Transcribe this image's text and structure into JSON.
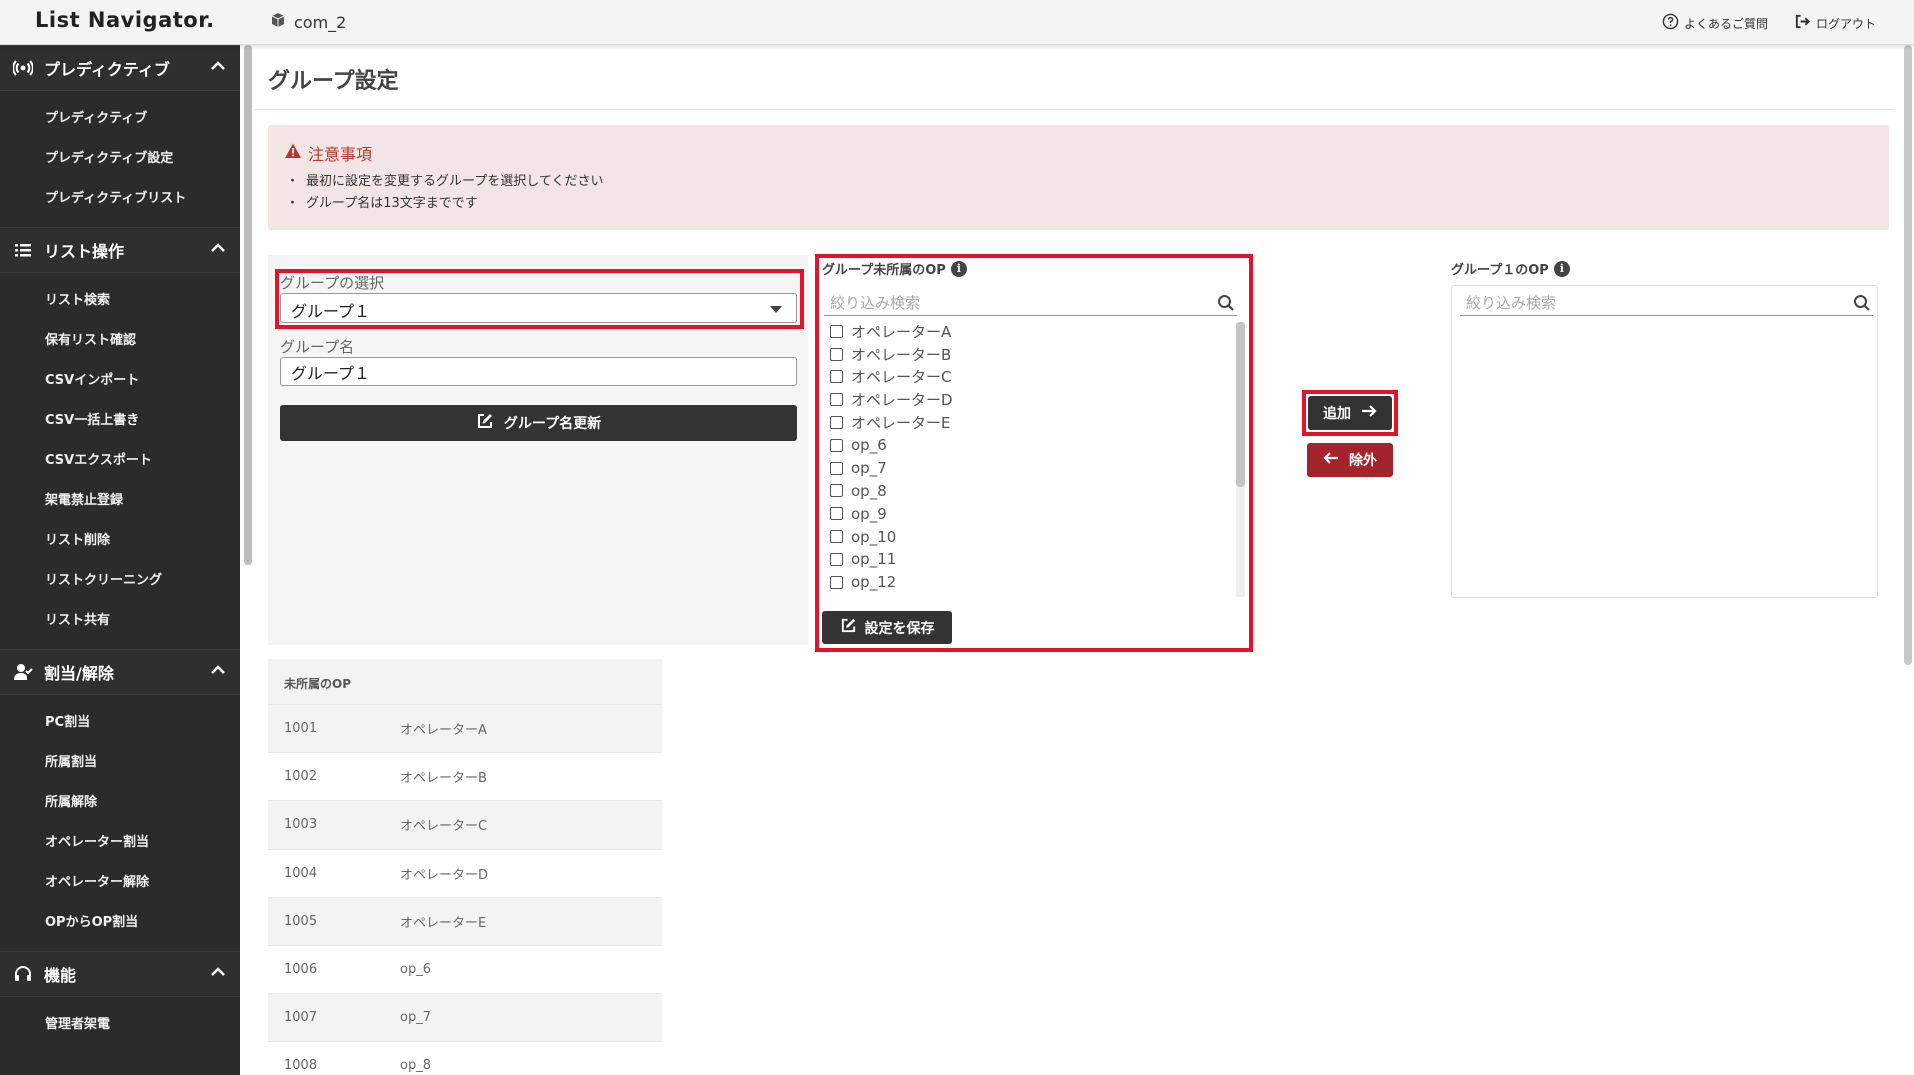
{
  "header": {
    "logo": "List Navigator.",
    "company": "com_2",
    "faq": "よくあるご質問",
    "logout": "ログアウト"
  },
  "sidebar": {
    "sections": [
      {
        "title": "プレディクティブ",
        "icon": "broadcast-icon",
        "items": [
          "プレディクティブ",
          "プレディクティブ設定",
          "プレディクティブリスト"
        ]
      },
      {
        "title": "リスト操作",
        "icon": "list-icon",
        "items": [
          "リスト検索",
          "保有リスト確認",
          "CSVインポート",
          "CSV一括上書き",
          "CSVエクスポート",
          "架電禁止登録",
          "リスト削除",
          "リストクリーニング",
          "リスト共有"
        ]
      },
      {
        "title": "割当/解除",
        "icon": "user-check-icon",
        "items": [
          "PC割当",
          "所属割当",
          "所属解除",
          "オペレーター割当",
          "オペレーター解除",
          "OPからOP割当"
        ]
      },
      {
        "title": "機能",
        "icon": "headset-icon",
        "items": [
          "管理者架電"
        ]
      }
    ]
  },
  "page": {
    "title": "グループ設定"
  },
  "notice": {
    "title": "注意事項",
    "lines": [
      "最初に設定を変更するグループを選択してください",
      "グループ名は13文字までです"
    ]
  },
  "form": {
    "select_label": "グループの選択",
    "select_value": "グループ１",
    "name_label": "グループ名",
    "name_value": "グループ１",
    "rename_button": "グループ名更新"
  },
  "unassigned": {
    "title": "グループ未所属のOP",
    "search_placeholder": "絞り込み検索",
    "items": [
      "オペレーターA",
      "オペレーターB",
      "オペレーターC",
      "オペレーターD",
      "オペレーターE",
      "op_6",
      "op_7",
      "op_8",
      "op_9",
      "op_10",
      "op_11",
      "op_12"
    ],
    "save_button": "設定を保存"
  },
  "actions": {
    "add": "追加",
    "remove": "除外"
  },
  "group_op": {
    "title": "グループ１のOP",
    "search_placeholder": "絞り込み検索"
  },
  "table": {
    "header": "未所属のOP",
    "rows": [
      [
        "1001",
        "オペレーターA"
      ],
      [
        "1002",
        "オペレーターB"
      ],
      [
        "1003",
        "オペレーターC"
      ],
      [
        "1004",
        "オペレーターD"
      ],
      [
        "1005",
        "オペレーターE"
      ],
      [
        "1006",
        "op_6"
      ],
      [
        "1007",
        "op_7"
      ],
      [
        "1008",
        "op_8"
      ]
    ]
  }
}
